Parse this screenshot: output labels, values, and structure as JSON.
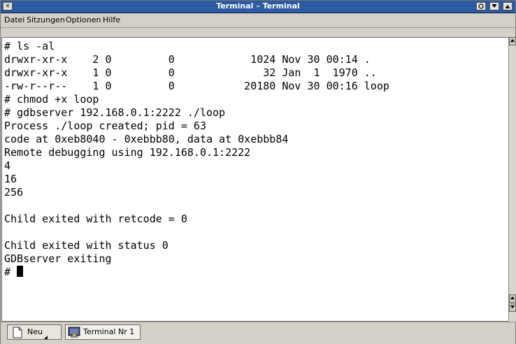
{
  "window": {
    "title": "Terminal – Terminal",
    "close_glyph": "×"
  },
  "menu": {
    "items": [
      "Datei",
      "Sitzungen",
      "Optionen",
      "Hilfe"
    ]
  },
  "terminal": {
    "lines": [
      "# ls -al",
      "drwxr-xr-x    2 0         0            1024 Nov 30 00:14 .",
      "drwxr-xr-x    1 0         0              32 Jan  1  1970 ..",
      "-rw-r--r--    1 0         0           20180 Nov 30 00:16 loop",
      "# chmod +x loop",
      "# gdbserver 192.168.0.1:2222 ./loop",
      "Process ./loop created; pid = 63",
      "code at 0xeb8040 - 0xebbb80, data at 0xebbb84",
      "Remote debugging using 192.168.0.1:2222",
      "4",
      "16",
      "256",
      "",
      "Child exited with retcode = 0",
      "",
      "Child exited with status 0",
      "GDBserver exiting"
    ],
    "prompt": "# "
  },
  "tabs": [
    {
      "label": "Neu",
      "icon": "new-document-icon"
    },
    {
      "label": "Terminal Nr 1",
      "icon": "terminal-icon"
    }
  ]
}
